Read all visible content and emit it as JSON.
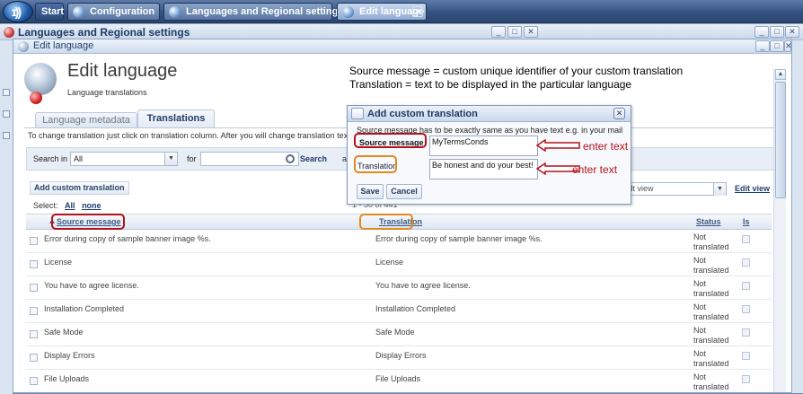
{
  "taskbar": {
    "start": "Start",
    "tasks": [
      {
        "label": "Configuration"
      },
      {
        "label": "Languages and Regional settings"
      },
      {
        "label": "Edit language"
      }
    ]
  },
  "bg_window": {
    "title": "Languages and Regional settings"
  },
  "main_window": {
    "title": "Edit language",
    "page_title": "Edit language",
    "page_subtitle": "Language translations",
    "note_line1": "Source message = custom unique identifier of your custom translation",
    "note_line2": "Translation = text to be displayed in the particular language"
  },
  "tabs": [
    {
      "label": "Language metadata"
    },
    {
      "label": "Translations"
    }
  ],
  "help_text": "To change translation just click on translation column. After you will change translation text, ",
  "filter": {
    "search_in_label": "Search in",
    "search_in_value": "All",
    "for_label": "for",
    "search_button": "Search",
    "more": "ad"
  },
  "actions": {
    "add_custom": "Add custom translation",
    "view_value": "fault view",
    "edit_view": "Edit view"
  },
  "select": {
    "label": "Select:",
    "all": "All",
    "none": "none"
  },
  "pager": "1 - 50 of 441",
  "grid": {
    "columns": {
      "source": "Source message",
      "translation": "Translation",
      "status": "Status",
      "is": "Is"
    },
    "rows": [
      {
        "source": "Error during copy of sample banner image %s.",
        "translation": "Error during copy of sample banner image %s.",
        "status1": "Not",
        "status2": "translated"
      },
      {
        "source": "License",
        "translation": "License",
        "status1": "Not",
        "status2": "translated"
      },
      {
        "source": "You have to agree license.",
        "translation": "You have to agree license.",
        "status1": "Not",
        "status2": "translated"
      },
      {
        "source": "Installation Completed",
        "translation": "Installation Completed",
        "status1": "Not",
        "status2": "translated"
      },
      {
        "source": "Safe Mode",
        "translation": "Safe Mode",
        "status1": "Not",
        "status2": "translated"
      },
      {
        "source": "Display Errors",
        "translation": "Display Errors",
        "status1": "Not",
        "status2": "translated"
      },
      {
        "source": "File Uploads",
        "translation": "File Uploads",
        "status1": "Not",
        "status2": "translated"
      }
    ]
  },
  "dialog": {
    "title": "Add custom translation",
    "hint": "Source message has to be exactly same as you have text e.g. in your mail",
    "source_label": "Source message",
    "source_value": "MyTermsConds",
    "translation_label": "Translation",
    "translation_value": "Be honest and do your best!",
    "save": "Save",
    "cancel": "Cancel"
  },
  "annotations": {
    "enter1": "enter text",
    "enter2": "enter text"
  },
  "colors": {
    "annotation_red": "#b3121b",
    "annotation_orange": "#e28a1e",
    "taskbar": "#34527f"
  }
}
